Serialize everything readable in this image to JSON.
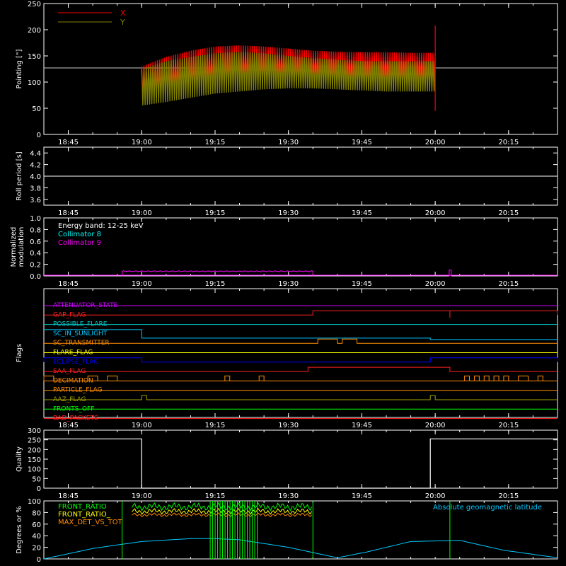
{
  "chart_data": [
    {
      "type": "line",
      "panel": "pointing",
      "ylabel": "Pointing [\"]",
      "xlim": [
        "18:40",
        "20:25"
      ],
      "ylim": [
        0,
        250
      ],
      "yticks": [
        0,
        50,
        100,
        150,
        200,
        250
      ],
      "xticks": [
        "18:45",
        "19:00",
        "19:15",
        "19:30",
        "19:45",
        "20:00",
        "20:15"
      ],
      "legend": {
        "placement": "top-left"
      },
      "series": [
        {
          "name": "X",
          "color": "#ff0000",
          "x": [
            "19:00",
            "19:05",
            "19:10",
            "19:15",
            "19:20",
            "19:25",
            "19:30",
            "19:35",
            "19:40",
            "19:45",
            "19:50",
            "19:55",
            "20:00"
          ],
          "upper": [
            130,
            148,
            160,
            168,
            170,
            168,
            164,
            160,
            158,
            157,
            157,
            156,
            156
          ],
          "lower": [
            75,
            80,
            90,
            96,
            100,
            104,
            106,
            108,
            108,
            108,
            108,
            108,
            108
          ]
        },
        {
          "name": "Y",
          "color": "#808000",
          "x": [
            "19:00",
            "19:05",
            "19:10",
            "19:15",
            "19:20",
            "19:25",
            "19:30",
            "19:35",
            "19:40",
            "19:45",
            "19:50",
            "19:55",
            "20:00"
          ],
          "upper": [
            125,
            140,
            148,
            155,
            158,
            155,
            150,
            146,
            143,
            140,
            140,
            140,
            140
          ],
          "lower": [
            55,
            62,
            70,
            78,
            82,
            86,
            88,
            88,
            86,
            84,
            82,
            82,
            82
          ]
        }
      ],
      "reference_line": {
        "y": 127,
        "color": "#cccccc"
      },
      "spikes": [
        {
          "x": "20:00",
          "max": 208,
          "min": 45
        }
      ]
    },
    {
      "type": "line",
      "panel": "roll",
      "ylabel": "Roll period [s]",
      "xlim": [
        "18:40",
        "20:25"
      ],
      "ylim": [
        3.5,
        4.5
      ],
      "yticks": [
        3.6,
        3.8,
        4.0,
        4.2,
        4.4
      ],
      "ytick_labels": [
        "3.6",
        "3.8",
        "4.0",
        "4.2",
        "4.4"
      ],
      "xticks": [
        "18:45",
        "19:00",
        "19:15",
        "19:30",
        "19:45",
        "20:00",
        "20:15"
      ],
      "series": [
        {
          "color": "#ffffff",
          "x": [
            "18:40",
            "20:25"
          ],
          "values": [
            4.0,
            4.0
          ]
        }
      ]
    },
    {
      "type": "line",
      "panel": "modulation",
      "ylabel": [
        "Normalized",
        "modulation"
      ],
      "xlim": [
        "18:40",
        "20:25"
      ],
      "ylim": [
        0,
        1
      ],
      "yticks": [
        0,
        0.2,
        0.4,
        0.6,
        0.8,
        1.0
      ],
      "ytick_labels": [
        "0.0",
        "0.2",
        "0.4",
        "0.6",
        "0.8",
        "1.0"
      ],
      "xticks": [
        "18:45",
        "19:00",
        "19:15",
        "19:30",
        "19:45",
        "20:00",
        "20:15"
      ],
      "annotation": "Energy band: 12-25 keV",
      "series": [
        {
          "name": "Collimator 8",
          "color": "#00ffff",
          "x": [],
          "values": []
        },
        {
          "name": "Collimator 9",
          "color": "#ff00ff",
          "segments": [
            {
              "from": "18:56",
              "to": "19:35",
              "level": 0.08
            }
          ],
          "spikes": [
            {
              "x": "20:03",
              "level": 0.1
            }
          ]
        }
      ]
    },
    {
      "type": "line",
      "panel": "flags",
      "ylabel": "Flags",
      "xlim": [
        "18:40",
        "20:25"
      ],
      "xticks": [
        "18:45",
        "19:00",
        "19:15",
        "19:30",
        "19:45",
        "20:00",
        "20:15"
      ],
      "flags": [
        {
          "name": "ATTENUATOR_STATE",
          "color": "#cc00ff",
          "transitions": []
        },
        {
          "name": "GAP_FLAG",
          "color": "#ff2020",
          "transitions": [
            {
              "from": "19:35",
              "to": "20:25",
              "state": 1
            }
          ],
          "spikes": [
            "20:03"
          ]
        },
        {
          "name": "POSSIBLE_FLARE",
          "color": "#00c8c8",
          "transitions": []
        },
        {
          "name": "SC_IN_SUNLIGHT",
          "color": "#00c8ff",
          "transitions": [
            {
              "from": "18:40",
              "to": "19:00",
              "state": 0
            },
            {
              "from": "19:00",
              "to": "19:59",
              "state": 1
            }
          ]
        },
        {
          "name": "SC_TRANSMITTER",
          "color": "#ff8c00",
          "transitions": [
            {
              "from": "19:36",
              "to": "19:40",
              "state": 1
            },
            {
              "from": "19:41",
              "to": "19:44",
              "state": 1
            }
          ]
        },
        {
          "name": "FLARE_FLAG",
          "color": "#ffff00",
          "transitions": []
        },
        {
          "name": "ECLIPSE_FLAG",
          "color": "#0000ff",
          "transitions": [
            {
              "from": "18:40",
              "to": "19:00",
              "state": 1
            },
            {
              "from": "19:59",
              "to": "20:25",
              "state": 1
            }
          ]
        },
        {
          "name": "SAA_FLAG",
          "color": "#ff2020",
          "transitions": [
            {
              "from": "19:34",
              "to": "20:03",
              "state": 1
            }
          ]
        },
        {
          "name": "DECIMATION",
          "color": "#ff8c00",
          "transitions": []
        },
        {
          "name": "PARTICLE_FLAG",
          "color": "#ff8c00",
          "transitions": []
        },
        {
          "name": "AAZ_FLAG",
          "color": "#a0a000",
          "transitions": [
            {
              "from": "19:00",
              "to": "19:01",
              "state": 1
            },
            {
              "from": "19:59",
              "to": "20:00",
              "state": 1
            }
          ]
        },
        {
          "name": "FRONTS_OFF",
          "color": "#00ff00",
          "transitions": []
        },
        {
          "name": "BAD_PACKETS",
          "color": "#ff2020",
          "transitions": []
        }
      ]
    },
    {
      "type": "line",
      "panel": "quality",
      "ylabel": "Quality",
      "xlim": [
        "18:40",
        "20:25"
      ],
      "ylim": [
        0,
        300
      ],
      "yticks": [
        0,
        50,
        100,
        150,
        200,
        250,
        300
      ],
      "xticks": [
        "18:45",
        "19:00",
        "19:15",
        "19:30",
        "19:45",
        "20:00",
        "20:15"
      ],
      "series": [
        {
          "color": "#ffffff",
          "x": [
            "18:40",
            "19:00",
            "19:00",
            "19:59",
            "19:59",
            "20:25"
          ],
          "values": [
            255,
            255,
            0,
            0,
            255,
            255
          ]
        }
      ]
    },
    {
      "type": "line",
      "panel": "ratios",
      "ylabel": "Degrees or %",
      "xlim": [
        "18:40",
        "20:25"
      ],
      "ylim": [
        0,
        100
      ],
      "yticks": [
        0,
        20,
        40,
        60,
        80,
        100
      ],
      "series": [
        {
          "name": "FRONT_RATIO",
          "color": "#00ff00"
        },
        {
          "name": "FRONT_RATIO_",
          "color": "#ffff00"
        },
        {
          "name": "MAX_DET_VS_TOT",
          "color": "#ff8c00"
        },
        {
          "name": "Absolute geomagnetic latitude",
          "color": "#00c8ff",
          "x": [
            "18:40",
            "18:50",
            "19:00",
            "19:10",
            "19:15",
            "19:20",
            "19:30",
            "19:40",
            "19:46",
            "19:55",
            "20:05",
            "20:14",
            "20:25"
          ],
          "values": [
            0,
            18,
            30,
            35,
            35,
            33,
            20,
            2,
            12,
            30,
            32,
            15,
            2
          ]
        }
      ]
    }
  ]
}
